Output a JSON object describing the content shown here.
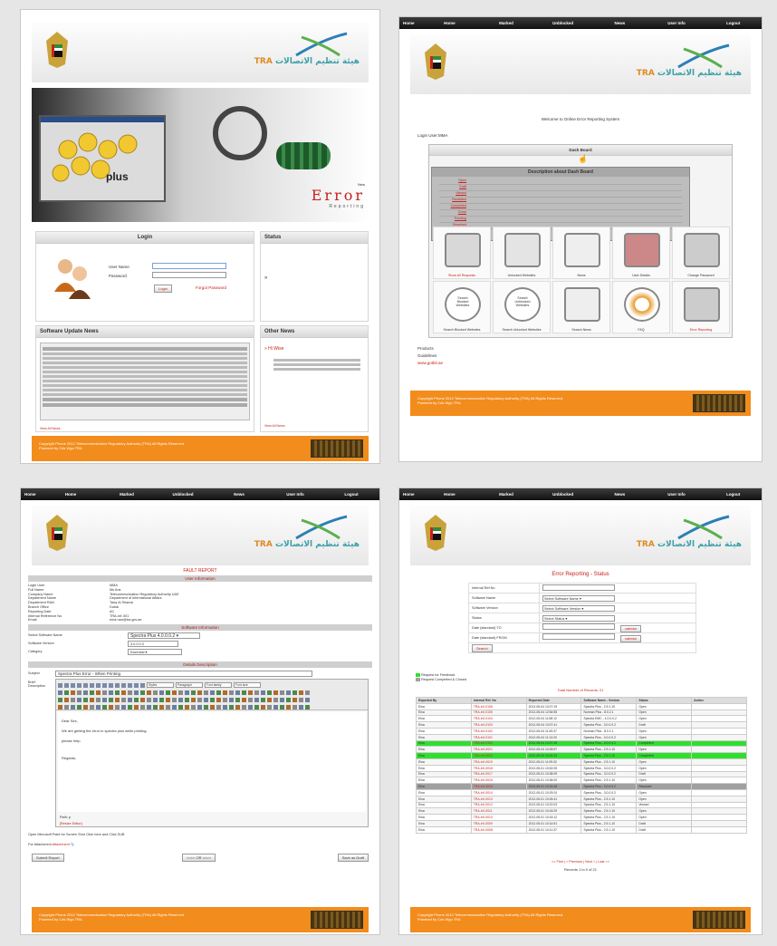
{
  "logo_text_en": "TRA",
  "colors": {
    "accent": "#f28c1c",
    "header_dark": "#1a1a1a",
    "link_red": "#c8201a",
    "row_green": "#2ee02e",
    "row_gray": "#a0a0a0"
  },
  "login_page": {
    "banner": {
      "product": "plus",
      "error_word": "Error",
      "reporting_word": "Reporting",
      "new_tag": "New"
    },
    "login": {
      "title": "Login",
      "username_label": "User Name",
      "password_label": "Password",
      "login_button": "Login",
      "forgot_link": "Forgot Password"
    },
    "status": {
      "title": "Status"
    },
    "software_news": {
      "title": "Software Update News",
      "view_all": "View All News"
    },
    "other_news": {
      "title": "Other News",
      "item_title": "Hi Wise",
      "view_all": "View All News"
    }
  },
  "menu": [
    "Home",
    "Home",
    "Marked",
    "Unblocked",
    "News",
    "User Info",
    "Logout"
  ],
  "dashboard": {
    "welcome": "Welcome to Online Error Reporting System",
    "login_user": "Login User:MMA",
    "dash_board_title": "Dash Board",
    "desc_title": "Description about Dash Board",
    "desc_terms": [
      "Open",
      "Draft",
      "Viewed",
      "Escalated",
      "Completed",
      "Close",
      "Pending",
      "Resolved"
    ],
    "tiles_row1": [
      "Show All Requests",
      "Unlocked Websites",
      "News",
      "User Details",
      "Change Password"
    ],
    "tiles_row2": [
      "Search Blocked Websites",
      "Search Unlocked Websites",
      "Search News",
      "FAQ",
      "Error Reporting"
    ],
    "tile_icon_text1": [
      "Search",
      "Blocked",
      "Websites"
    ],
    "tile_icon_text2": [
      "Search",
      "Unblocked",
      "Websites"
    ],
    "extra_links": [
      "Products",
      "Guidelines",
      "www.gotbit.ae"
    ]
  },
  "fault_report": {
    "title": "FAULT REPORT",
    "user_info_title": "User Information",
    "user_labels": [
      "Login User",
      "Full Name",
      "Company Name",
      "Department Name",
      "Department RAN",
      "Branch Office",
      "Reporting Date",
      "Internal Reference No",
      "Email"
    ],
    "user_values": [
      "MMA",
      "Ms Ans",
      "Telecommunication Regulatory Authority UAE",
      "Department of International Affairs",
      "Tariq Al Shamsi",
      "Dubai",
      "AC",
      "TRA-Int'-001",
      "ema.ram@tra.gov.ae"
    ],
    "software_info_title": "Software Information",
    "software_labels": [
      "Select Software Name",
      "Software Version",
      "Category"
    ],
    "software_name": "Spectra Plus 4.0.0.0.2",
    "software_version": "3.0.0.0.3",
    "category": "Essential",
    "details_title": "Details Description",
    "subject_label": "Subject",
    "brief_label": "Brief Description",
    "subject_value": "Spectra Plus Error - When Printing",
    "editor_selects": [
      "Styles",
      "Paragraph",
      "Font family",
      "Font size"
    ],
    "editor_lines": [
      "Dear Sirs,",
      "We are getting the error in spectra plus while printing.",
      "please help.",
      "Regards,"
    ],
    "path_text": "Path: p",
    "resize_link": "[Resize Editor]",
    "attach_line": "Open Microsoft Paint for Screen Shot Click here and Click SUB",
    "attachment_label": "For Attachment",
    "attachment_link": "Attachment",
    "buttons": [
      "Submit Report",
      "<<<< OR >>>>",
      "Save as Draft"
    ]
  },
  "status_page": {
    "title": "Error Reporting - Status",
    "form_labels": [
      "Internal Ref No",
      "Software Name",
      "Software Version",
      "Status",
      "Date (standard) TO",
      "Date (standard) FROM"
    ],
    "selects": [
      "Select Software Name",
      "Select Software Version",
      "Select Status"
    ],
    "calendar_button": "calendar",
    "search_button": "Search",
    "legend": [
      "Request for Feedback",
      "Request Completed & Closed"
    ],
    "total_records": "Total Number of Records: 21",
    "columns": [
      "Reported By",
      "Internal Ref. No",
      "Reported Date",
      "Software Name - Version",
      "Status",
      "Action"
    ],
    "rows": [
      [
        "Eina",
        "TRA-Int'-0106",
        "2012-05-04 13:27:19",
        "Spectra Plus - 2.9.1.10",
        "Open",
        "",
        "n"
      ],
      [
        "Eina",
        "TRA-Int'-0105",
        "2012-05-04 12:54:55",
        "Norman Plus - 8.0.2.1",
        "Open",
        "",
        "n"
      ],
      [
        "Eina",
        "TRA-Int'-0104",
        "2012-05-04 11:58:12",
        "Spectra EMC - 4.0.0.0.2",
        "Open",
        "",
        "n"
      ],
      [
        "Eina",
        "TRA-Int'-0103",
        "2012-05-04 13:07:41",
        "Spectra Plus - 3.0.0.0.2",
        "Draft",
        "",
        "n"
      ],
      [
        "Eina",
        "TRA-Int'-0102",
        "2012-05-04 11:49:37",
        "Norman Plus - 8.0.2.1",
        "Open",
        "",
        "n"
      ],
      [
        "Eina",
        "TRA-Int'-0101",
        "2012-05-04 11:13:20",
        "Spectra Plus - 3.0.0.0.2",
        "Open",
        "",
        "n"
      ],
      [
        "Eina",
        "TRA-Int'-0100",
        "2012-05-04 10:57:48",
        "Spectra Plus - 3.0.0.0.2",
        "Completed",
        "",
        "g"
      ],
      [
        "Eina",
        "TRA-Int'-0021",
        "2012-05-04 10:28:57",
        "Spectra Plus - 2.9.1.10",
        "Open",
        "",
        "n"
      ],
      [
        "Eina",
        "TRA-Int'-0020",
        "2012-05-04 10:24:10",
        "Spectra Plus - 2.9.1.10",
        "Completed",
        "",
        "g"
      ],
      [
        "Eina",
        "TRA-Int'-0019",
        "2012-05-01 11:09:32",
        "Spectra Plus - 2.9.1.10",
        "Open",
        "",
        "n"
      ],
      [
        "Eina",
        "TRA-Int'-0018",
        "2012-05-01 10:52:05",
        "Spectra Plus - 3.0.0.0.2",
        "Open",
        "",
        "n"
      ],
      [
        "Eina",
        "TRA-Int'-0017",
        "2012-05-01 10:38:09",
        "Spectra Plus - 3.0.0.0.2",
        "Draft",
        "",
        "n"
      ],
      [
        "Eina",
        "TRA-Int'-0016",
        "2012-05-01 10:36:00",
        "Spectra Plus - 2.9.1.10",
        "Open",
        "",
        "n"
      ],
      [
        "Eina",
        "TRA-Int'-0015",
        "2012-05-01 10:31:45",
        "Spectra Plus - 3.0.0.0.2",
        "Resolved",
        "",
        "d"
      ],
      [
        "Eina",
        "TRA-Int'-0014",
        "2012-05-01 10:29:24",
        "Spectra Plus - 3.0.0.0.2",
        "Open",
        "",
        "n"
      ],
      [
        "Eina",
        "TRA-Int'-0013",
        "2012-05-01 10:26:41",
        "Spectra Plus - 2.9.1.10",
        "Open",
        "",
        "n"
      ],
      [
        "Eina",
        "TRA-Int'-0012",
        "2012-05-01 10:22:03",
        "Spectra Plus - 2.9.1.10",
        "Viewed",
        "",
        "n"
      ],
      [
        "Eina",
        "TRA-Int'-0011",
        "2012-05-01 10:18:29",
        "Spectra Plus - 2.9.1.10",
        "Open",
        "",
        "n"
      ],
      [
        "Eina",
        "TRA-Int'-0010",
        "2012-05-01 10:16:12",
        "Spectra Plus - 2.9.1.10",
        "Open",
        "",
        "n"
      ],
      [
        "Eina",
        "TRA-Int'-0009",
        "2012-05-01 10:14:51",
        "Spectra Plus - 2.9.1.10",
        "Draft",
        "",
        "n"
      ],
      [
        "Eina",
        "TRA-Int'-0008",
        "2012-05-01 10:11:37",
        "Spectra Plus - 2.9.1.10",
        "Draft",
        "",
        "n"
      ]
    ],
    "pager": "<< First | < Previous | Next > | Last >>",
    "records_text": "Records 1 to 0 of 21"
  },
  "footer": {
    "copyright": "Copyright Phone 2012 Telecommunication Regulatory Authority (TRA) All Rights Reserved.",
    "powered": "Powered by Cds Wgo TRA"
  }
}
